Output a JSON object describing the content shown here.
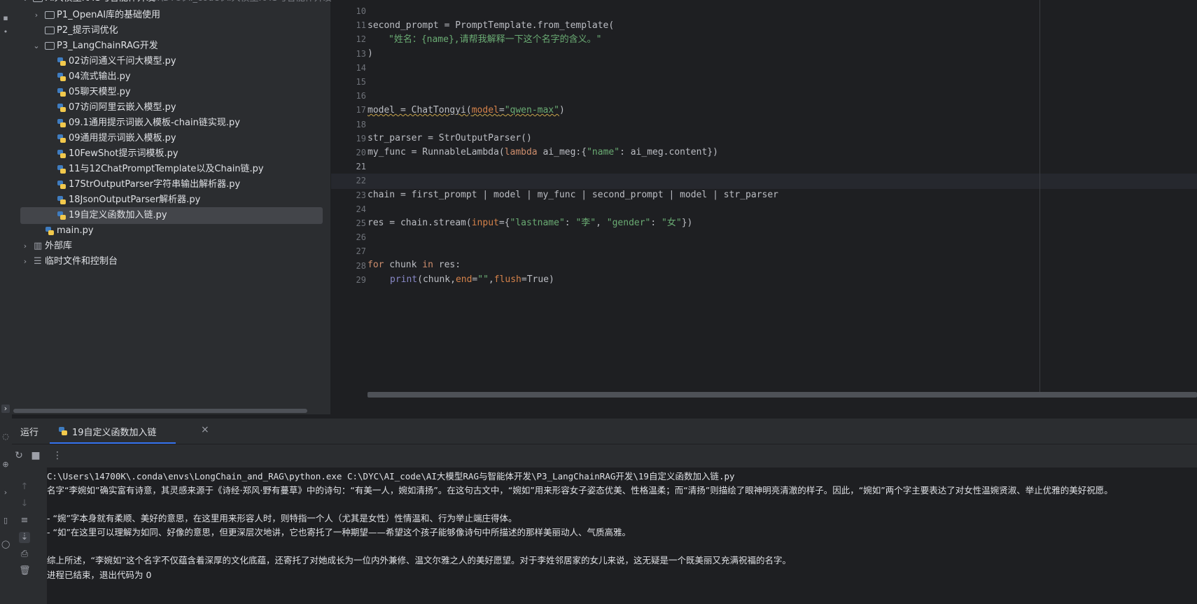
{
  "project_tree": {
    "root_label": "AI大模型RAG与智能体开发",
    "root_path": "C:\\DYC\\AI_code\\AI大模型RAG与智能体开发",
    "folders": [
      {
        "label": "P1_OpenAI库的基础使用"
      },
      {
        "label": "P2_提示词优化"
      },
      {
        "label": "P3_LangChainRAG开发"
      }
    ],
    "files": [
      "02访问通义千问大模型.py",
      "04流式输出.py",
      "05聊天模型.py",
      "07访问阿里云嵌入模型.py",
      "09.1通用提示词嵌入模板-chain链实现.py",
      "09通用提示词嵌入模板.py",
      "10FewShot提示词模板.py",
      "11与12ChatPromptTemplate以及Chain链.py",
      "17StrOutputParser字符串输出解析器.py",
      "18JsonOutputParser解析器.py",
      "19自定义函数加入链.py"
    ],
    "main_file": "main.py",
    "external_libs": "外部库",
    "scratches": "临时文件和控制台"
  },
  "editor": {
    "line_numbers": [
      "10",
      "11",
      "12",
      "13",
      "14",
      "15",
      "16",
      "17",
      "18",
      "19",
      "20",
      "21",
      "22",
      "23",
      "24",
      "25",
      "26",
      "27",
      "28",
      "29"
    ],
    "code": {
      "l11": "second_prompt = PromptTemplate.from_template(",
      "l12": "\"姓名：{name},请帮我解释一下这个名字的含义。\"",
      "l13": ")",
      "l17a": "model = ChatTongyi(",
      "l17b": "model",
      "l17c": "=",
      "l17d": "\"qwen-max\"",
      "l17e": ")",
      "l19": "str_parser = StrOutputParser()",
      "l20a": "my_func = RunnableLambda(",
      "l20b": "lambda",
      "l20c": " ai_meg:{",
      "l20d": "\"name\"",
      "l20e": ": ai_meg.content})",
      "l23": "chain = first_prompt | model | my_func | second_prompt | model | str_parser",
      "l25a": "res = chain.stream(",
      "l25b": "input",
      "l25c": "={",
      "l25d": "\"lastname\"",
      "l25e": ": ",
      "l25f": "\"李\"",
      "l25g": ", ",
      "l25h": "\"gender\"",
      "l25i": ": ",
      "l25j": "\"女\"",
      "l25k": "})",
      "l28a": "for",
      "l28b": " chunk ",
      "l28c": "in",
      "l28d": " res:",
      "l29a": "print",
      "l29b": "(chunk,",
      "l29c": "end",
      "l29d": "=",
      "l29e": "\"\"",
      "l29f": ",",
      "l29g": "flush",
      "l29h": "=True)"
    }
  },
  "run_panel": {
    "title": "运行",
    "tab_label": "19自定义函数加入链",
    "console_lines": [
      "C:\\Users\\14700K\\.conda\\envs\\LongChain_and_RAG\\python.exe C:\\DYC\\AI_code\\AI大模型RAG与智能体开发\\P3_LangChainRAG开发\\19自定义函数加入链.py",
      "名字“李婉如”确实富有诗意，其灵感来源于《诗经·郑风·野有蔓草》中的诗句：“有美一人，婉如清扬”。在这句古文中，“婉如”用来形容女子姿态优美、性格温柔；而“清扬”则描绘了眼神明亮清澈的样子。因此，“婉如”两个字主要表达了对女性温婉贤淑、举止优雅的美好祝愿。",
      "",
      "- “婉”字本身就有柔顺、美好的意思，在这里用来形容人时，则特指一个人（尤其是女性）性情温和、行为举止端庄得体。",
      "- “如”在这里可以理解为如同、好像的意思，但更深层次地讲，它也寄托了一种期望——希望这个孩子能够像诗句中所描述的那样美丽动人、气质高雅。",
      "",
      "综上所述，“李婉如”这个名字不仅蕴含着深厚的文化底蕴，还寄托了对她成长为一位内外兼修、温文尔雅之人的美好愿望。对于李姓邻居家的女儿来说，这无疑是一个既美丽又充满祝福的名字。",
      "进程已结束，退出代码为 0"
    ]
  },
  "colors": {
    "accent": "#3574f0",
    "keyword": "#cf8e6d",
    "string": "#6aab73",
    "param": "#d5824a",
    "builtin": "#8888c6"
  }
}
